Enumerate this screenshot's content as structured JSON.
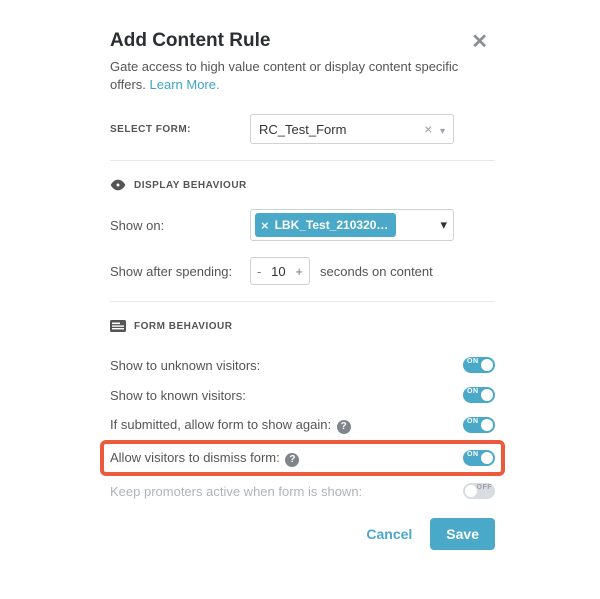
{
  "modal": {
    "title": "Add Content Rule",
    "description": "Gate access to high value content or display content specific offers. ",
    "learn_more": "Learn More."
  },
  "select_form": {
    "label": "SELECT FORM:",
    "value": "RC_Test_Form"
  },
  "sections": {
    "display": {
      "title": "DISPLAY BEHAVIOUR",
      "show_on_label": "Show on:",
      "selected_tag": "LBK_Test_210320…",
      "spend_label": "Show after spending:",
      "spend_value": "10",
      "spend_suffix": "seconds on content"
    },
    "form": {
      "title": "FORM BEHAVIOUR",
      "rows": [
        {
          "label": "Show to unknown visitors:",
          "on": true,
          "help": false,
          "disabled": false
        },
        {
          "label": "Show to known visitors:",
          "on": true,
          "help": false,
          "disabled": false
        },
        {
          "label": "If submitted, allow form to show again:",
          "on": true,
          "help": true,
          "disabled": false
        },
        {
          "label": "Allow visitors to dismiss form:",
          "on": true,
          "help": true,
          "disabled": false,
          "highlight": true
        },
        {
          "label": "Keep promoters active when form is shown:",
          "on": false,
          "help": false,
          "disabled": true
        }
      ]
    }
  },
  "toggle_labels": {
    "on": "ON",
    "off": "OFF"
  },
  "actions": {
    "cancel": "Cancel",
    "save": "Save"
  }
}
